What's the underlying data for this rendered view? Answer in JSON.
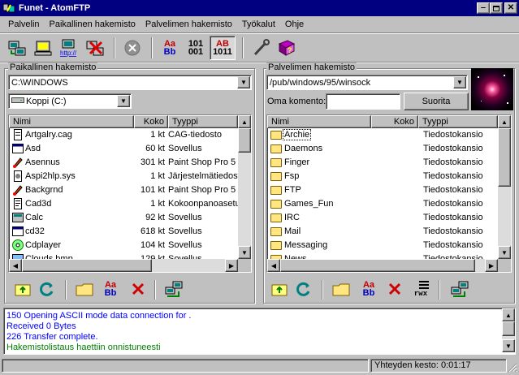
{
  "window": {
    "title": "Funet - AtomFTP"
  },
  "menu": [
    "Palvelin",
    "Paikallinen hakemisto",
    "Palvelimen hakemisto",
    "Työkalut",
    "Ohje"
  ],
  "toolbar": {
    "font_case_label_top": "Aa",
    "font_case_label_bottom": "Bb",
    "binary_label_top": "101",
    "binary_label_bottom": "001",
    "ascii_label_top": "AB",
    "ascii_label_bottom": "1011"
  },
  "local": {
    "group_label": "Paikallinen hakemisto",
    "path": "C:\\WINDOWS",
    "drive": "Koppi (C:)",
    "columns": [
      "Nimi",
      "Koko",
      "Tyyppi"
    ],
    "files": [
      {
        "name": "Artgalry.cag",
        "size": "1 kt",
        "type": "CAG-tiedosto",
        "icon": "document-icon"
      },
      {
        "name": "Asd",
        "size": "60 kt",
        "type": "Sovellus",
        "icon": "app-icon"
      },
      {
        "name": "Asennus",
        "size": "301 kt",
        "type": "Paint Shop Pro 5 Im",
        "icon": "paint-icon"
      },
      {
        "name": "Aspi2hlp.sys",
        "size": "1 kt",
        "type": "Järjestelmätiedosto",
        "icon": "system-file-icon"
      },
      {
        "name": "Backgrnd",
        "size": "101 kt",
        "type": "Paint Shop Pro 5 Im",
        "icon": "paint-icon"
      },
      {
        "name": "Cad3d",
        "size": "1 kt",
        "type": "Kokoonpanoasetukse",
        "icon": "settings-file-icon"
      },
      {
        "name": "Calc",
        "size": "92 kt",
        "type": "Sovellus",
        "icon": "calculator-icon"
      },
      {
        "name": "cd32",
        "size": "618 kt",
        "type": "Sovellus",
        "icon": "app-icon"
      },
      {
        "name": "Cdplayer",
        "size": "104 kt",
        "type": "Sovellus",
        "icon": "cd-icon"
      },
      {
        "name": "Clouds.bmp",
        "size": "129 kt",
        "type": "Sovellus",
        "icon": "image-icon"
      }
    ]
  },
  "remote": {
    "group_label": "Palvelimen hakemisto",
    "path": "/pub/windows/95/winsock",
    "command_label": "Oma komento:",
    "command_value": "",
    "run_button": "Suorita",
    "columns": [
      "Nimi",
      "Koko",
      "Tyyppi"
    ],
    "files": [
      {
        "name": "Archie",
        "size": "",
        "type": "Tiedostokansio"
      },
      {
        "name": "Daemons",
        "size": "",
        "type": "Tiedostokansio"
      },
      {
        "name": "Finger",
        "size": "",
        "type": "Tiedostokansio"
      },
      {
        "name": "Fsp",
        "size": "",
        "type": "Tiedostokansio"
      },
      {
        "name": "FTP",
        "size": "",
        "type": "Tiedostokansio"
      },
      {
        "name": "Games_Fun",
        "size": "",
        "type": "Tiedostokansio"
      },
      {
        "name": "IRC",
        "size": "",
        "type": "Tiedostokansio"
      },
      {
        "name": "Mail",
        "size": "",
        "type": "Tiedostokansio"
      },
      {
        "name": "Messaging",
        "size": "",
        "type": "Tiedostokansio"
      },
      {
        "name": "News",
        "size": "",
        "type": "Tiedostokansio"
      }
    ]
  },
  "panel_tools": {
    "rename_top": "Aa",
    "rename_bottom": "Bb",
    "rwx_label": "rwx"
  },
  "log": [
    {
      "text": "150 Opening ASCII mode data connection for .",
      "color": "#0000ff"
    },
    {
      "text": "Received 0 Bytes",
      "color": "#0000ff"
    },
    {
      "text": "226 Transfer complete.",
      "color": "#0000ff"
    },
    {
      "text": "Hakemistolistaus haettiin onnistuneesti",
      "color": "#008000"
    }
  ],
  "status": {
    "connection_time": "Yhteyden kesto: 0:01:17"
  }
}
